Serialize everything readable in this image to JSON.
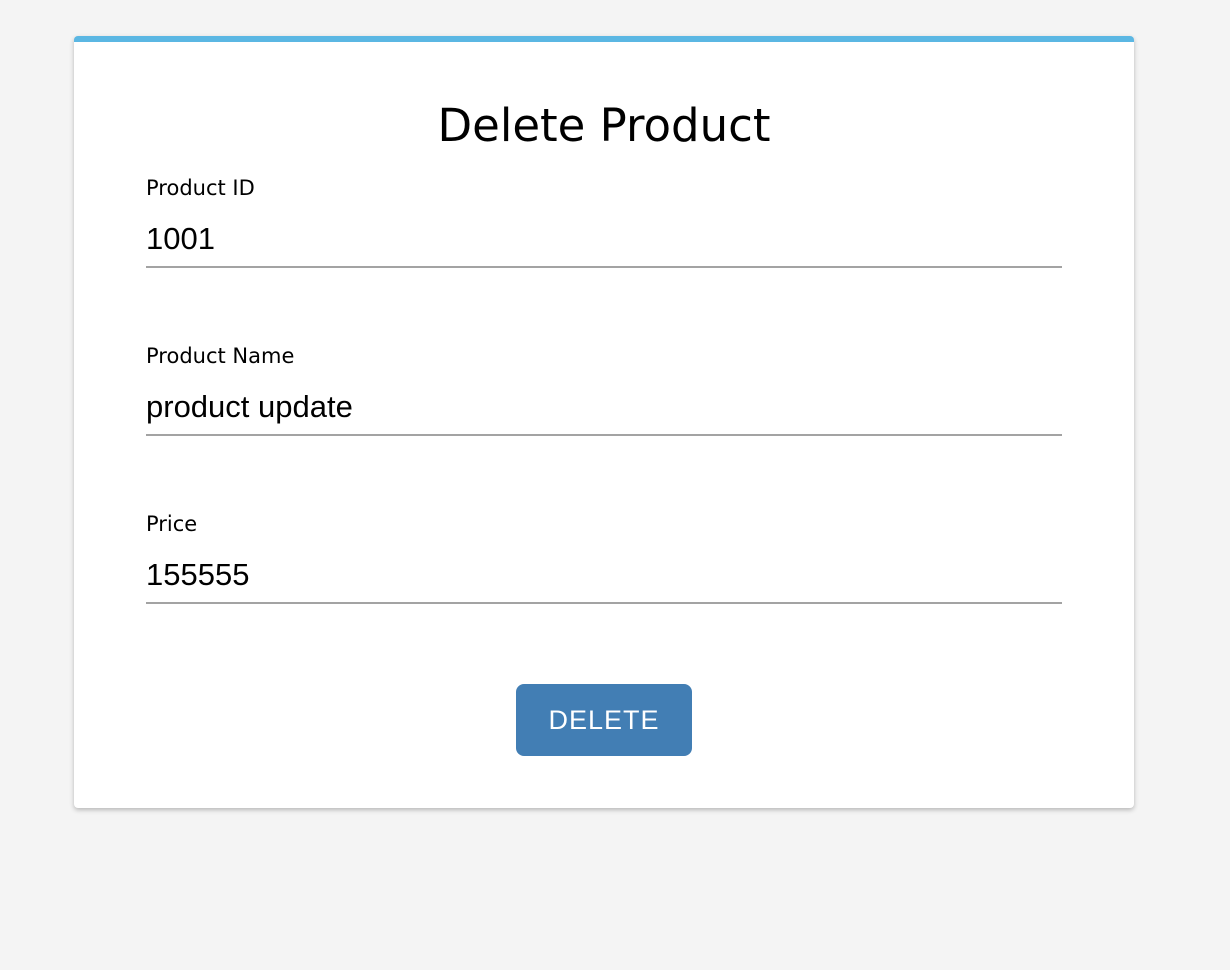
{
  "form": {
    "title": "Delete Product",
    "accent_color": "#5bb7e3",
    "fields": [
      {
        "label": "Product ID",
        "value": "1001"
      },
      {
        "label": "Product Name",
        "value": "product update"
      },
      {
        "label": "Price",
        "value": "155555"
      }
    ],
    "submit": {
      "label": "DELETE",
      "color": "#427eb4"
    }
  }
}
